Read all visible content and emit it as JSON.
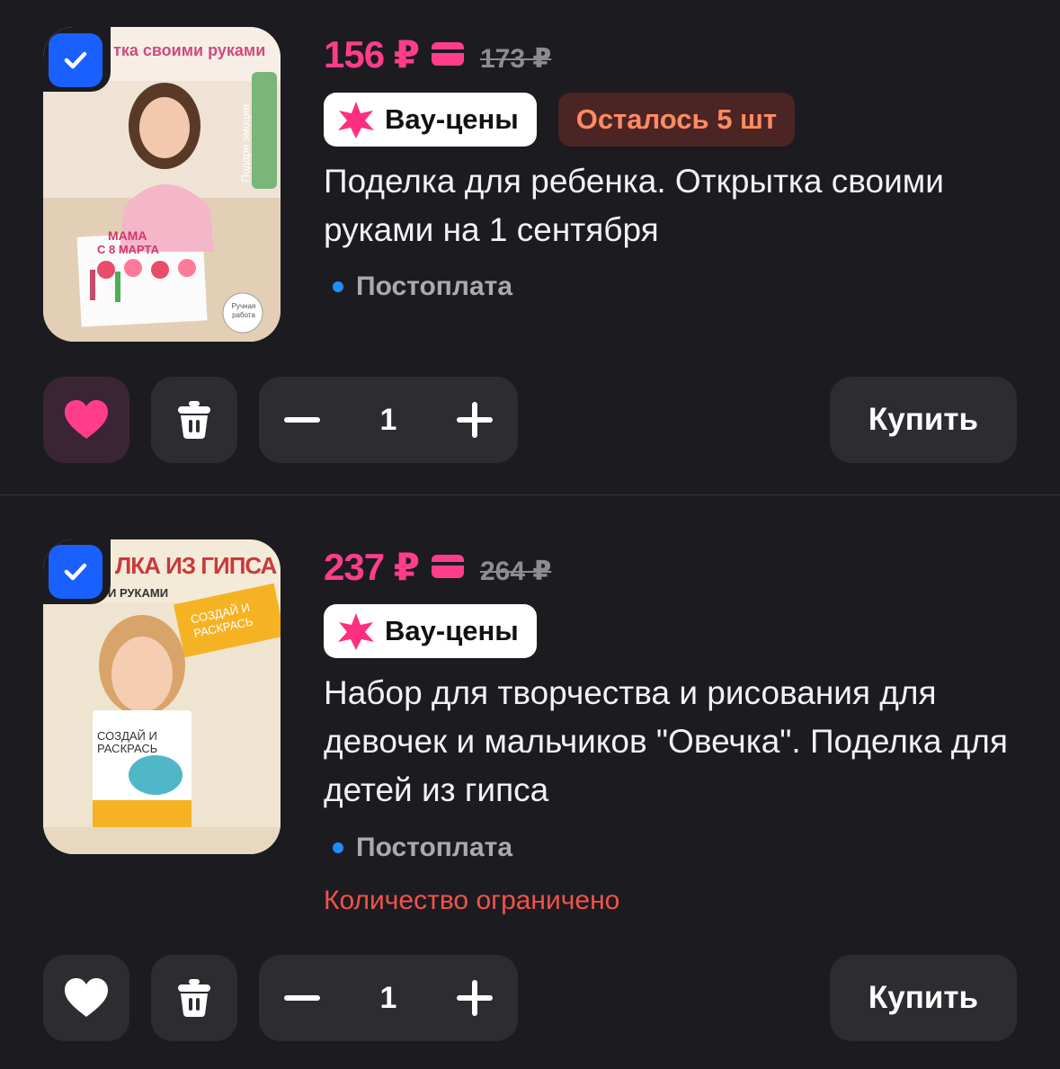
{
  "colors": {
    "accent": "#ff3d8b",
    "checkbox": "#1a60ff",
    "background": "#1c1c20",
    "warning": "#f2524b"
  },
  "items": [
    {
      "selected": true,
      "price": "156 ₽",
      "old_price": "173 ₽",
      "badge_wow": "Вау-цены",
      "badge_stock": "Осталось 5 шт",
      "title": "Поделка для ребенка. Открытка своими руками на 1 сентября",
      "payment": "Постоплата",
      "image_text": {
        "top": "тка своими руками",
        "side": "Подари эмоции",
        "card_line1": "МАМА",
        "card_line2": "С 8 МАРТА",
        "stamp": "Ручная работа"
      },
      "liked": true,
      "like_icon": "heart-filled-icon",
      "delete_icon": "trash-icon",
      "quantity": "1",
      "buy_label": "Купить"
    },
    {
      "selected": true,
      "price": "237 ₽",
      "old_price": "264 ₽",
      "badge_wow": "Вау-цены",
      "title": "Набор для творчества и рисования для девочек и мальчиков \"Овечка\". Поделка для детей из гипса",
      "payment": "Постоплата",
      "limited": "Количество ограничено",
      "image_text": {
        "top": "ЛКА ИЗ ГИПСА",
        "sub": "И РУКАМИ",
        "ribbon": "СОЗДАЙ И РАСКРАСЬ",
        "box": "СОЗДАЙ И РАСКРАСЬ"
      },
      "liked": false,
      "like_icon": "heart-outline-icon",
      "delete_icon": "trash-icon",
      "quantity": "1",
      "buy_label": "Купить"
    }
  ]
}
